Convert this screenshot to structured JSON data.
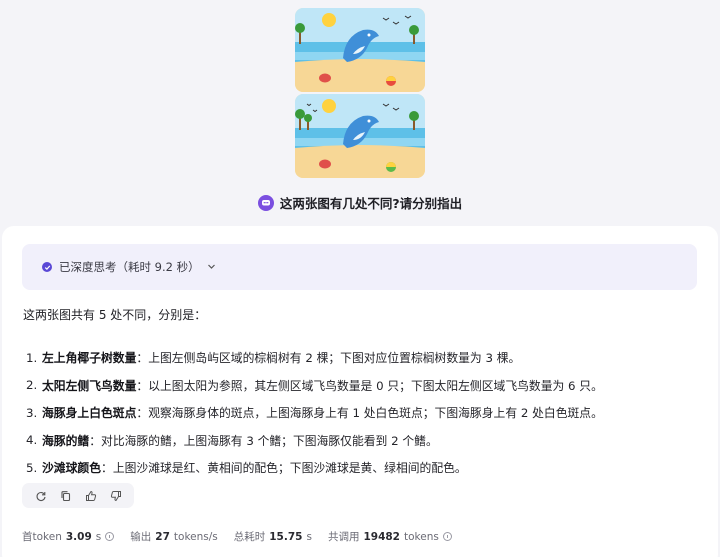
{
  "question": {
    "text": "这两张图有几处不同?请分别指出"
  },
  "thinking": {
    "label": "已深度思考（耗时 9.2 秒）"
  },
  "answer": {
    "intro": "这两张图共有 5 处不同，分别是：",
    "items": [
      {
        "num": "1.",
        "title": "左上角椰子树数量",
        "sep": "：",
        "body": "上图左侧岛屿区域的棕榈树有 2 棵；下图对应位置棕榈树数量为 3 棵。"
      },
      {
        "num": "2.",
        "title": "太阳左侧飞鸟数量",
        "sep": "：",
        "body": "以上图太阳为参照，其左侧区域飞鸟数量是 0 只；下图太阳左侧区域飞鸟数量为 6 只。"
      },
      {
        "num": "3.",
        "title": "海豚身上白色斑点",
        "sep": "：",
        "body": "观察海豚身体的斑点，上图海豚身上有 1 处白色斑点；下图海豚身上有 2 处白色斑点。"
      },
      {
        "num": "4.",
        "title": "海豚的鳍",
        "sep": "：",
        "body": "对比海豚的鳍，上图海豚有 3 个鳍；下图海豚仅能看到 2 个鳍。"
      },
      {
        "num": "5.",
        "title": "沙滩球颜色",
        "sep": "：",
        "body": "上图沙滩球是红、黄相间的配色；下图沙滩球是黄、绿相间的配色。"
      }
    ]
  },
  "actions": [
    "refresh-icon",
    "copy-icon",
    "thumbs-up-icon",
    "thumbs-down-icon"
  ],
  "stats": {
    "first_token_label": "首token",
    "first_token_value": "3.09",
    "first_token_unit": "s",
    "output_label": "输出",
    "output_value": "27",
    "output_unit": "tokens/s",
    "total_label": "总耗时",
    "total_value": "15.75",
    "total_unit": "s",
    "calls_label": "共调用",
    "calls_value": "19482",
    "calls_unit": "tokens"
  },
  "colors": {
    "accent": "#5a48d6",
    "question_icon": "#7b4fe0",
    "think_bg": "#f1f0fb"
  }
}
